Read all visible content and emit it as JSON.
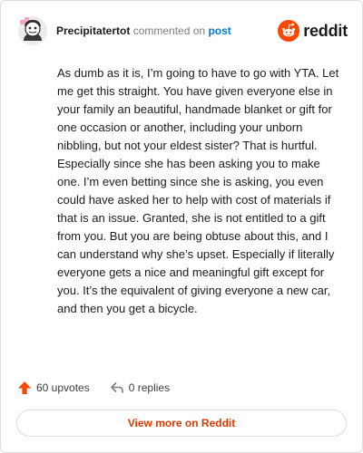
{
  "header": {
    "username": "Precipitatertot",
    "commented_text": "commented on",
    "post_link": "post",
    "brand_name": "reddit",
    "avatar_icon": "snoo-avatar-icon",
    "brand_icon": "reddit-logo-icon"
  },
  "comment": {
    "body": "As dumb as it is, I’m going to have to go with YTA. Let me get this straight. You have given everyone else in your family an beautiful, handmade blanket or gift for one occasion or another, including your unborn nibbling, but not your eldest sister? That is hurtful. Especially since she has been asking you to make one. I’m even betting since she is asking, you even could have asked her to help with cost of materials if that is an issue. Granted, she is not entitled to a gift from you. But you are being obtuse about this, and I can understand why she’s upset. Especially if literally everyone gets a nice and meaningful gift except for you. It’s the equivalent of giving everyone a new car, and then you get a bicycle."
  },
  "stats": {
    "upvotes_label": "60 upvotes",
    "replies_label": "0 replies",
    "upvote_icon": "upvote-arrow-icon",
    "reply_icon": "reply-arrow-icon"
  },
  "actions": {
    "view_more_label": "View more on Reddit"
  },
  "colors": {
    "accent": "#d93a00",
    "upvote": "#ff4500",
    "link": "#0079d3",
    "border": "#dadde0"
  }
}
